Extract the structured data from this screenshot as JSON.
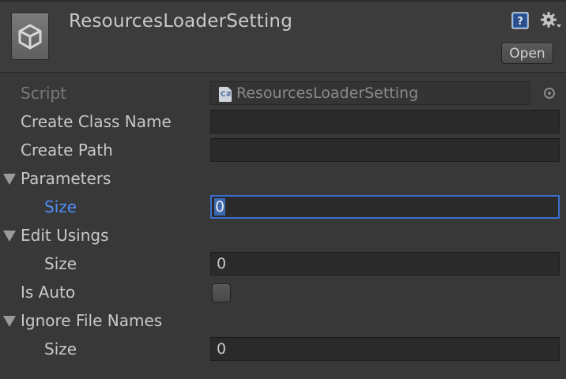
{
  "header": {
    "title": "ResourcesLoaderSetting",
    "open_label": "Open",
    "icons": {
      "logo": "unity-logo-icon",
      "help": "help-book-icon",
      "settings": "gear-dropdown-icon"
    }
  },
  "fields": {
    "script": {
      "label": "Script",
      "value": "ResourcesLoaderSetting"
    },
    "create_class_name": {
      "label": "Create Class Name",
      "value": ""
    },
    "create_path": {
      "label": "Create Path",
      "value": ""
    },
    "parameters": {
      "label": "Parameters",
      "size_label": "Size",
      "size_value": "0"
    },
    "edit_usings": {
      "label": "Edit Usings",
      "size_label": "Size",
      "size_value": "0"
    },
    "is_auto": {
      "label": "Is Auto",
      "checked": false
    },
    "ignore_file_names": {
      "label": "Ignore File Names",
      "size_label": "Size",
      "size_value": "0"
    }
  },
  "colors": {
    "background": "#383838",
    "focus_accent": "#4e8ef7",
    "selection": "#3d69b3"
  }
}
